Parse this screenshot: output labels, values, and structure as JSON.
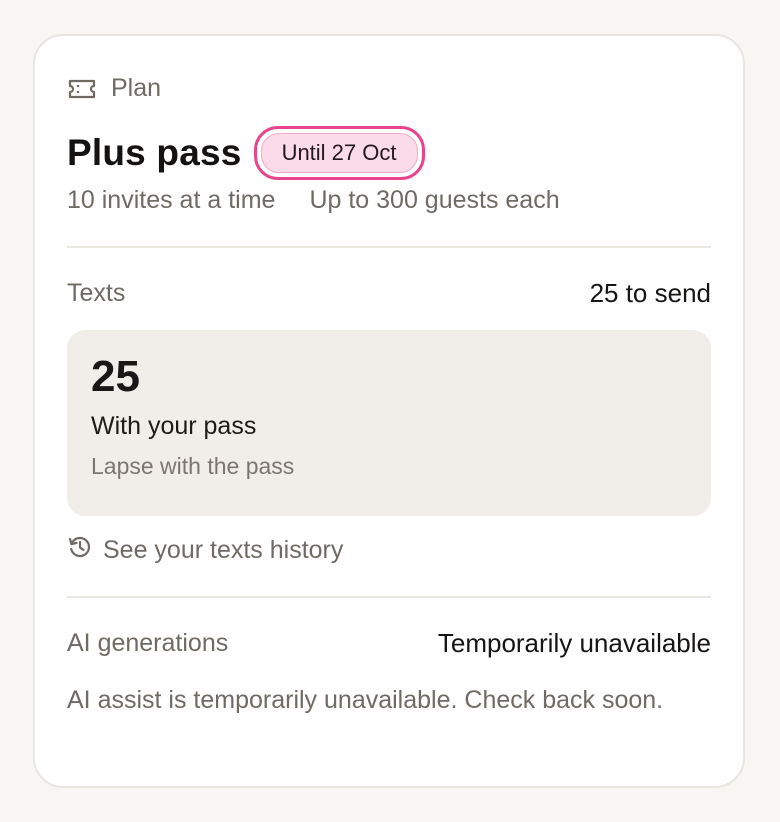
{
  "plan": {
    "section_label": "Plan",
    "icon": "ticket-icon",
    "title": "Plus pass",
    "badge": "Until 27 Oct",
    "features": [
      "10 invites at a time",
      "Up to 300 guests each"
    ]
  },
  "texts": {
    "label": "Texts",
    "summary": "25 to send",
    "count": "25",
    "source_title": "With your pass",
    "source_note": "Lapse with the pass",
    "history_icon": "history-icon",
    "history_link": "See your texts history"
  },
  "ai": {
    "label": "AI generations",
    "status": "Temporarily unavailable",
    "description": "AI assist is temporarily unavailable. Check back soon."
  },
  "colors": {
    "badge_ring": "#e8458e",
    "badge_fill": "#fbdbe8",
    "muted_text": "#6f6a64",
    "panel_bg": "#f1eee9"
  }
}
